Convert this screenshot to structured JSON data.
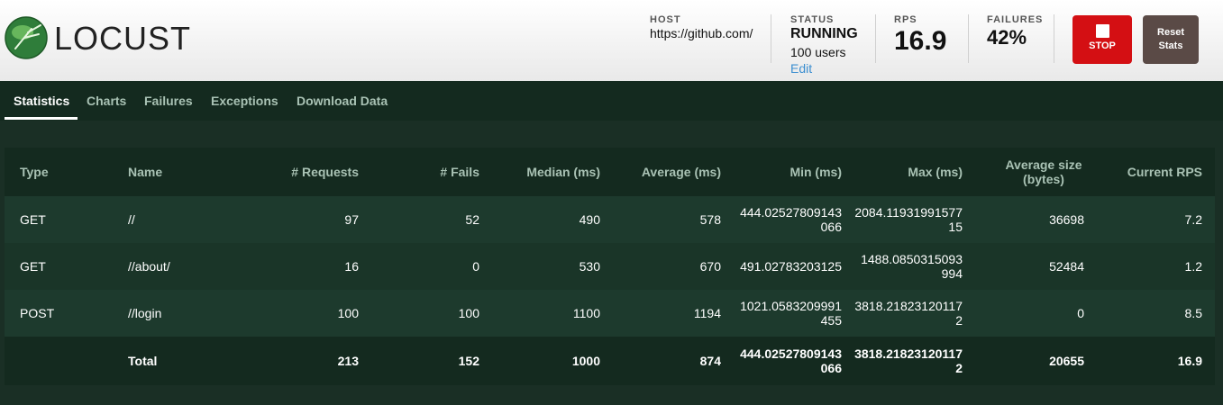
{
  "brand": {
    "name": "LOCUST"
  },
  "header": {
    "host": {
      "label": "HOST",
      "value": "https://github.com/"
    },
    "status": {
      "label": "STATUS",
      "value": "RUNNING",
      "users": "100 users",
      "edit": "Edit"
    },
    "rps": {
      "label": "RPS",
      "value": "16.9"
    },
    "failures": {
      "label": "FAILURES",
      "value": "42%"
    },
    "stop_label": "STOP",
    "reset_label_1": "Reset",
    "reset_label_2": "Stats"
  },
  "tabs": [
    {
      "label": "Statistics",
      "active": true
    },
    {
      "label": "Charts"
    },
    {
      "label": "Failures"
    },
    {
      "label": "Exceptions"
    },
    {
      "label": "Download Data"
    }
  ],
  "table": {
    "columns": [
      "Type",
      "Name",
      "# Requests",
      "# Fails",
      "Median (ms)",
      "Average (ms)",
      "Min (ms)",
      "Max (ms)",
      "Average size (bytes)",
      "Current RPS"
    ],
    "rows": [
      [
        "GET",
        "//",
        "97",
        "52",
        "490",
        "578",
        "444.02527809143066",
        "2084.1193199157715",
        "36698",
        "7.2"
      ],
      [
        "GET",
        "//about/",
        "16",
        "0",
        "530",
        "670",
        "491.02783203125",
        "1488.0850315093994",
        "52484",
        "1.2"
      ],
      [
        "POST",
        "//login",
        "100",
        "100",
        "1100",
        "1194",
        "1021.0583209991455",
        "3818.218231201172",
        "0",
        "8.5"
      ]
    ],
    "total": [
      "",
      "Total",
      "213",
      "152",
      "1000",
      "874",
      "444.02527809143066",
      "3818.218231201172",
      "20655",
      "16.9"
    ]
  },
  "colors": {
    "stop": "#d40f13",
    "reset": "#5a4a46",
    "page_bg": "#1a2f25",
    "accent_link": "#3b8ed0"
  }
}
